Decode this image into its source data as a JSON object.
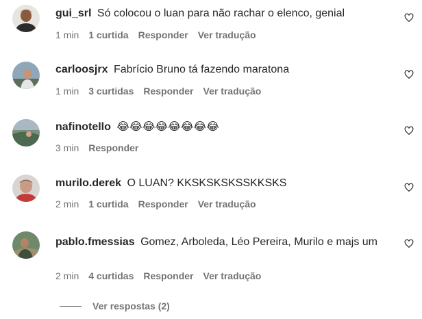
{
  "comments": [
    {
      "username": "gui_srl",
      "text": "Só colocou o luan para não rachar o elenco, genial",
      "time": "1 min",
      "likes": "1 curtida",
      "reply": "Responder",
      "translate": "Ver tradução",
      "avatar_icon": "user-avatar"
    },
    {
      "username": "carloosjrx",
      "text": "Fabrício Bruno tá fazendo maratona",
      "time": "1 min",
      "likes": "3 curtidas",
      "reply": "Responder",
      "translate": "Ver tradução",
      "avatar_icon": "user-avatar"
    },
    {
      "username": "nafinotello",
      "text": "😂😂😂😂😂😂😂😂",
      "time": "3 min",
      "likes": "",
      "reply": "Responder",
      "translate": "",
      "avatar_icon": "user-avatar"
    },
    {
      "username": "murilo.derek",
      "text": "O LUAN? KKSKSKSKSSKKSKS",
      "time": "2 min",
      "likes": "1 curtida",
      "reply": "Responder",
      "translate": "Ver tradução",
      "avatar_icon": "user-avatar"
    },
    {
      "username": "pablo.fmessias",
      "text": "Gomez, Arboleda, Léo Pereira, Murilo e majs um",
      "time": "2 min",
      "likes": "4 curtidas",
      "reply": "Responder",
      "translate": "Ver tradução",
      "avatar_icon": "user-avatar"
    }
  ],
  "view_replies": "Ver respostas (2)",
  "colors": {
    "text_primary": "#262626",
    "text_secondary": "#737373",
    "background": "#ffffff"
  },
  "icons": {
    "like": "heart-outline-icon"
  }
}
